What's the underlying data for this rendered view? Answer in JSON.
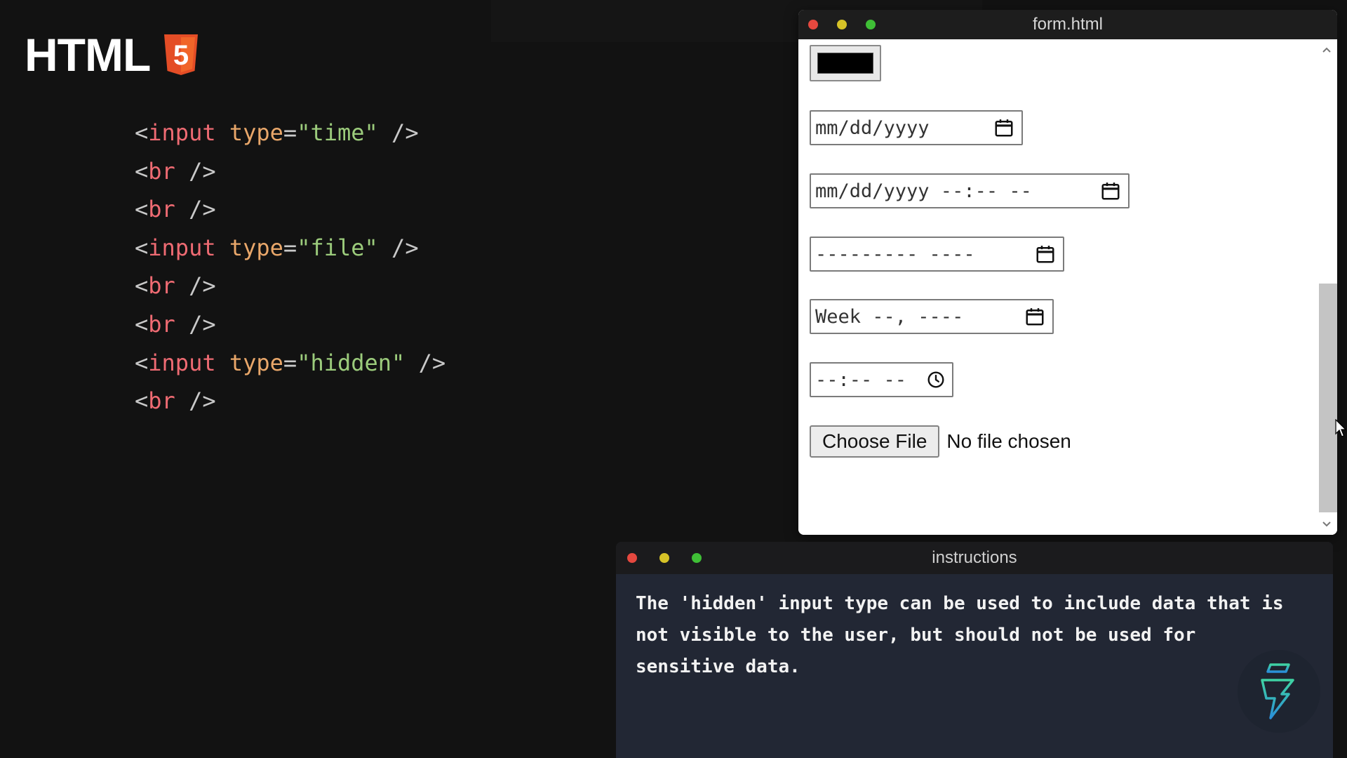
{
  "logo": {
    "text": "HTML",
    "shield_number": "5",
    "icon": "html5-shield-icon",
    "accent_color": "#e44d26"
  },
  "code": {
    "lines": [
      {
        "open": "<",
        "tag": "input",
        "attr": "type",
        "eq": "=",
        "value": "\"time\"",
        "close": " />"
      },
      {
        "open": "<",
        "tag": "br",
        "close": " />"
      },
      {
        "open": "<",
        "tag": "br",
        "close": " />"
      },
      {
        "open": "<",
        "tag": "input",
        "attr": "type",
        "eq": "=",
        "value": "\"file\"",
        "close": " />"
      },
      {
        "open": "<",
        "tag": "br",
        "close": " />"
      },
      {
        "open": "<",
        "tag": "br",
        "close": " />"
      },
      {
        "open": "<",
        "tag": "input",
        "attr": "type",
        "eq": "=",
        "value": "\"hidden\"",
        "close": " />"
      },
      {
        "open": "<",
        "tag": "br",
        "close": " />"
      }
    ]
  },
  "browser": {
    "title": "form.html",
    "color_input": {
      "value": "#000000"
    },
    "date_input": {
      "placeholder": "mm/dd/yyyy",
      "icon": "calendar-icon"
    },
    "datetime_input": {
      "placeholder": "mm/dd/yyyy --:-- --",
      "icon": "calendar-icon"
    },
    "month_input": {
      "placeholder": "--------- ----",
      "icon": "calendar-icon"
    },
    "week_input": {
      "placeholder": "Week --, ----",
      "icon": "calendar-icon"
    },
    "time_input": {
      "placeholder": "--:-- --",
      "icon": "clock-icon"
    },
    "file_input": {
      "button_label": "Choose File",
      "status": "No file chosen"
    }
  },
  "instructions": {
    "title": "instructions",
    "text": "The 'hidden' input type can be used to include data that is not visible to the user, but should not be used for sensitive data."
  },
  "badge": {
    "icon": "lightning-bolt-icon"
  }
}
